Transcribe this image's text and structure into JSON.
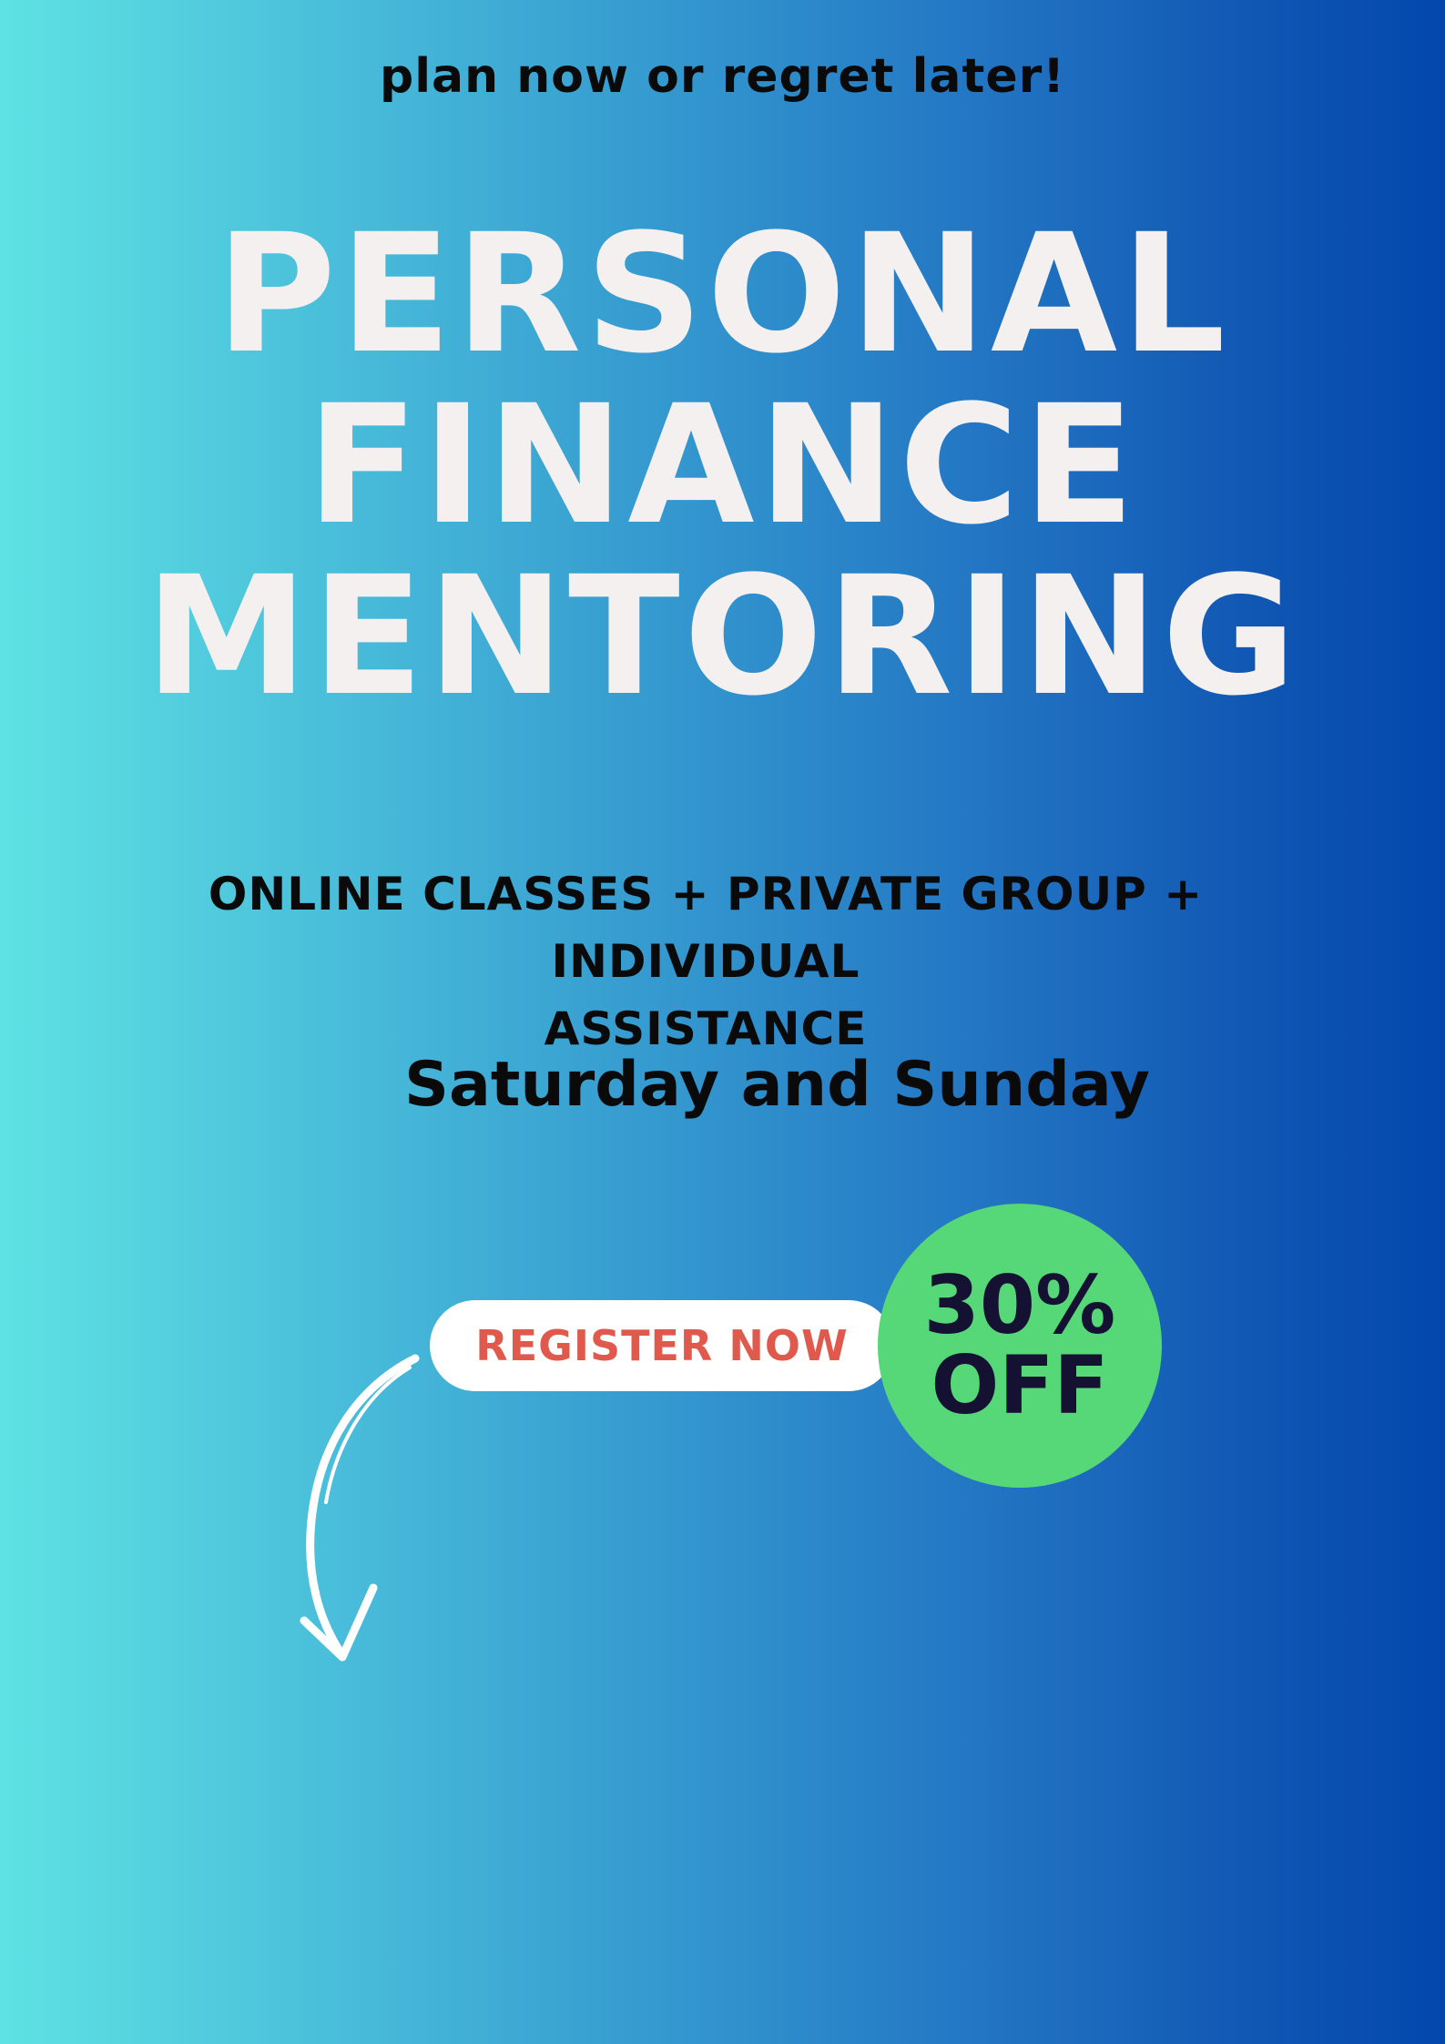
{
  "flyer": {
    "tagline": "plan now or regret later!",
    "headline": {
      "line1": "PERSONAL",
      "line2": "FINANCE",
      "line3": "MENTORING"
    },
    "features": {
      "line1": "ONLINE CLASSES + PRIVATE GROUP + INDIVIDUAL",
      "line2": "ASSISTANCE"
    },
    "schedule": "Saturday and Sunday",
    "register_label": "REGISTER NOW",
    "discount": {
      "line1": "30%",
      "line2": "OFF"
    },
    "icons": {
      "arrow": "curved-arrow-down-icon"
    }
  },
  "colors": {
    "gradient_start": "#5ee2e3",
    "gradient_end": "#0347ad",
    "headline": "#f4f0f0",
    "text_dark": "#0a0a0a",
    "register_text": "#df5a4c",
    "badge_bg": "#56d778",
    "badge_text": "#141133"
  }
}
